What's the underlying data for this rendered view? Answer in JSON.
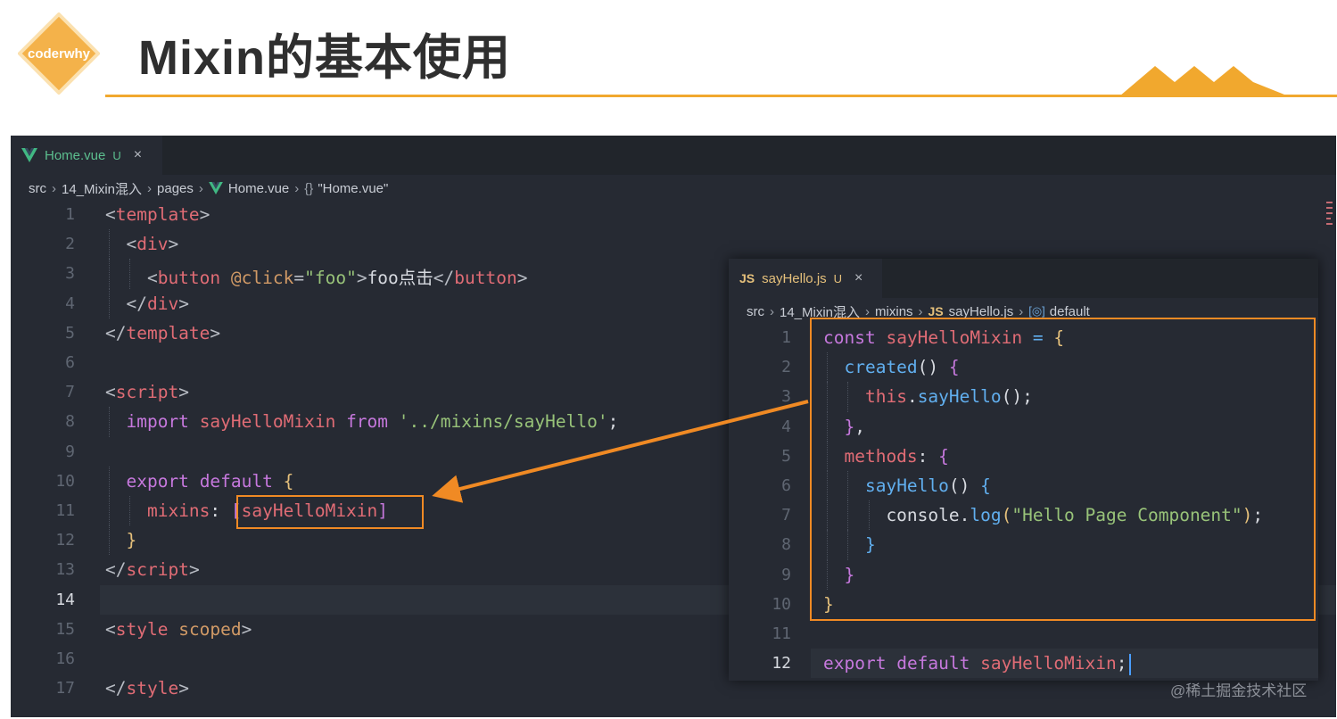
{
  "header": {
    "logo_text": "coderwhy",
    "title": "Mixin的基本使用"
  },
  "colors": {
    "accent": "#f1a82e",
    "highlight_box": "#f08a24",
    "editor_bg": "#262a33",
    "vue_green": "#5cbf8f"
  },
  "home_editor": {
    "tab": {
      "icon": "vue-icon",
      "name": "Home.vue",
      "status": "U",
      "close": "×"
    },
    "breadcrumb": [
      "src",
      "14_Mixin混入",
      "pages",
      "Home.vue",
      "\"Home.vue\""
    ],
    "active_line": "14",
    "lines": [
      {
        "n": "1",
        "tokens": [
          [
            "t-punc",
            "<"
          ],
          [
            "t-tag",
            "template"
          ],
          [
            "t-punc",
            ">"
          ]
        ]
      },
      {
        "n": "2",
        "tokens": [
          [
            "t-punc",
            "  <"
          ],
          [
            "t-tag",
            "div"
          ],
          [
            "t-punc",
            ">"
          ]
        ]
      },
      {
        "n": "3",
        "tokens": [
          [
            "t-punc",
            "    <"
          ],
          [
            "t-tag",
            "button"
          ],
          [
            "t-plain",
            " "
          ],
          [
            "t-attr",
            "@click"
          ],
          [
            "t-punc",
            "="
          ],
          [
            "t-str",
            "\"foo\""
          ],
          [
            "t-punc",
            ">"
          ],
          [
            "t-text",
            "foo点击"
          ],
          [
            "t-punc",
            "</"
          ],
          [
            "t-tag",
            "button"
          ],
          [
            "t-punc",
            ">"
          ]
        ]
      },
      {
        "n": "4",
        "tokens": [
          [
            "t-punc",
            "  </"
          ],
          [
            "t-tag",
            "div"
          ],
          [
            "t-punc",
            ">"
          ]
        ]
      },
      {
        "n": "5",
        "tokens": [
          [
            "t-punc",
            "</"
          ],
          [
            "t-tag",
            "template"
          ],
          [
            "t-punc",
            ">"
          ]
        ]
      },
      {
        "n": "6",
        "tokens": []
      },
      {
        "n": "7",
        "tokens": [
          [
            "t-punc",
            "<"
          ],
          [
            "t-tag",
            "script"
          ],
          [
            "t-punc",
            ">"
          ]
        ]
      },
      {
        "n": "8",
        "tokens": [
          [
            "t-plain",
            "  "
          ],
          [
            "t-kw",
            "import"
          ],
          [
            "t-plain",
            " "
          ],
          [
            "t-prop",
            "sayHelloMixin"
          ],
          [
            "t-plain",
            " "
          ],
          [
            "t-kw",
            "from"
          ],
          [
            "t-plain",
            " "
          ],
          [
            "t-str",
            "'../mixins/sayHello'"
          ],
          [
            "t-plain",
            ";"
          ]
        ]
      },
      {
        "n": "9",
        "tokens": []
      },
      {
        "n": "10",
        "tokens": [
          [
            "t-plain",
            "  "
          ],
          [
            "t-kw",
            "export"
          ],
          [
            "t-plain",
            " "
          ],
          [
            "t-kw",
            "default"
          ],
          [
            "t-plain",
            " "
          ],
          [
            "t-brace",
            "{"
          ]
        ]
      },
      {
        "n": "11",
        "tokens": [
          [
            "t-plain",
            "    "
          ],
          [
            "t-prop",
            "mixins"
          ],
          [
            "t-plain",
            ": "
          ],
          [
            "t-brace2",
            "["
          ],
          [
            "t-prop",
            "sayHelloMixin"
          ],
          [
            "t-brace2",
            "]"
          ]
        ]
      },
      {
        "n": "12",
        "tokens": [
          [
            "t-plain",
            "  "
          ],
          [
            "t-brace",
            "}"
          ]
        ]
      },
      {
        "n": "13",
        "tokens": [
          [
            "t-punc",
            "</"
          ],
          [
            "t-tag",
            "script"
          ],
          [
            "t-punc",
            ">"
          ]
        ]
      },
      {
        "n": "14",
        "tokens": []
      },
      {
        "n": "15",
        "tokens": [
          [
            "t-punc",
            "<"
          ],
          [
            "t-tag",
            "style"
          ],
          [
            "t-plain",
            " "
          ],
          [
            "t-attr",
            "scoped"
          ],
          [
            "t-punc",
            ">"
          ]
        ]
      },
      {
        "n": "16",
        "tokens": []
      },
      {
        "n": "17",
        "tokens": [
          [
            "t-punc",
            "</"
          ],
          [
            "t-tag",
            "style"
          ],
          [
            "t-punc",
            ">"
          ]
        ]
      }
    ]
  },
  "mixin_editor": {
    "tab": {
      "icon": "JS",
      "name": "sayHello.js",
      "status": "U",
      "close": "×"
    },
    "breadcrumb": [
      "src",
      "14_Mixin混入",
      "mixins",
      "sayHello.js",
      "default"
    ],
    "breadcrumb_js_badge": "JS",
    "active_line": "12",
    "lines": [
      {
        "n": "1",
        "tokens": [
          [
            "t-kw",
            "const"
          ],
          [
            "t-plain",
            " "
          ],
          [
            "t-prop",
            "sayHelloMixin"
          ],
          [
            "t-plain",
            " "
          ],
          [
            "t-fn",
            "="
          ],
          [
            "t-plain",
            " "
          ],
          [
            "t-brace",
            "{"
          ]
        ]
      },
      {
        "n": "2",
        "tokens": [
          [
            "t-plain",
            "  "
          ],
          [
            "t-fn",
            "created"
          ],
          [
            "t-plain",
            "() "
          ],
          [
            "t-brace2",
            "{"
          ]
        ]
      },
      {
        "n": "3",
        "tokens": [
          [
            "t-plain",
            "    "
          ],
          [
            "t-prop",
            "this"
          ],
          [
            "t-plain",
            "."
          ],
          [
            "t-fn",
            "sayHello"
          ],
          [
            "t-plain",
            "();"
          ]
        ]
      },
      {
        "n": "4",
        "tokens": [
          [
            "t-plain",
            "  "
          ],
          [
            "t-brace2",
            "}"
          ],
          [
            "t-plain",
            ","
          ]
        ]
      },
      {
        "n": "5",
        "tokens": [
          [
            "t-plain",
            "  "
          ],
          [
            "t-prop",
            "methods"
          ],
          [
            "t-plain",
            ": "
          ],
          [
            "t-brace2",
            "{"
          ]
        ]
      },
      {
        "n": "6",
        "tokens": [
          [
            "t-plain",
            "    "
          ],
          [
            "t-fn",
            "sayHello"
          ],
          [
            "t-plain",
            "() "
          ],
          [
            "t-brace3",
            "{"
          ]
        ]
      },
      {
        "n": "7",
        "tokens": [
          [
            "t-plain",
            "      console."
          ],
          [
            "t-fn",
            "log"
          ],
          [
            "t-brace",
            "("
          ],
          [
            "t-str",
            "\"Hello Page Component\""
          ],
          [
            "t-brace",
            ")"
          ],
          [
            "t-plain",
            ";"
          ]
        ]
      },
      {
        "n": "8",
        "tokens": [
          [
            "t-plain",
            "    "
          ],
          [
            "t-brace3",
            "}"
          ]
        ]
      },
      {
        "n": "9",
        "tokens": [
          [
            "t-plain",
            "  "
          ],
          [
            "t-brace2",
            "}"
          ]
        ]
      },
      {
        "n": "10",
        "tokens": [
          [
            "t-brace",
            "}"
          ]
        ]
      },
      {
        "n": "11",
        "tokens": []
      },
      {
        "n": "12",
        "tokens": [
          [
            "t-kw",
            "export"
          ],
          [
            "t-plain",
            " "
          ],
          [
            "t-kw",
            "default"
          ],
          [
            "t-plain",
            " "
          ],
          [
            "t-prop",
            "sayHelloMixin"
          ],
          [
            "t-plain",
            ";"
          ]
        ]
      }
    ]
  },
  "watermark": "@稀土掘金技术社区"
}
